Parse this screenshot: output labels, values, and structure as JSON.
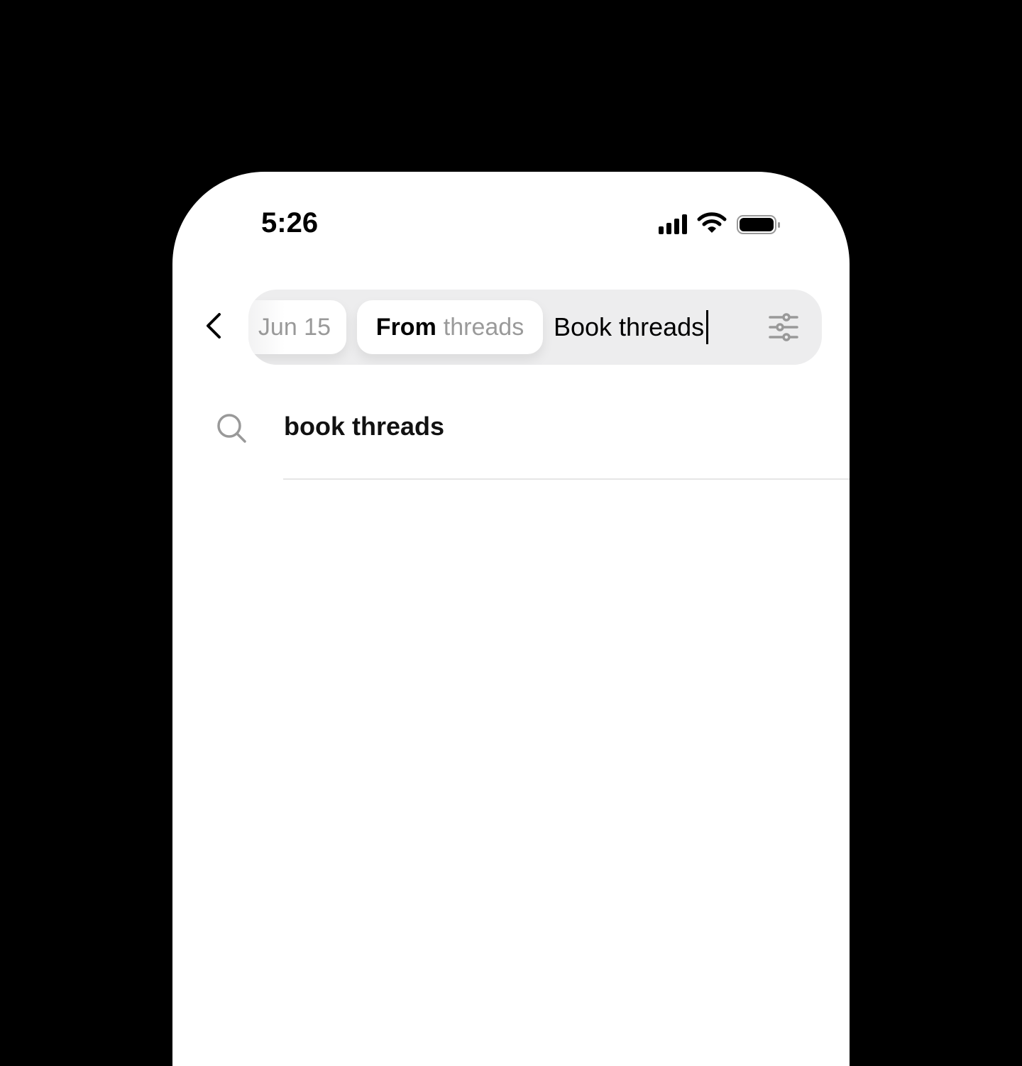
{
  "status_bar": {
    "time": "5:26",
    "icons": [
      "signal-icon",
      "wifi-icon",
      "battery-icon"
    ]
  },
  "search": {
    "chips": [
      {
        "label": "Jun 15"
      },
      {
        "key": "From",
        "value": "threads"
      }
    ],
    "query": "Book threads",
    "icons": [
      "back-chevron-icon",
      "filter-sliders-icon"
    ]
  },
  "suggestions": [
    {
      "text": "book threads",
      "icon": "search-icon"
    }
  ]
}
